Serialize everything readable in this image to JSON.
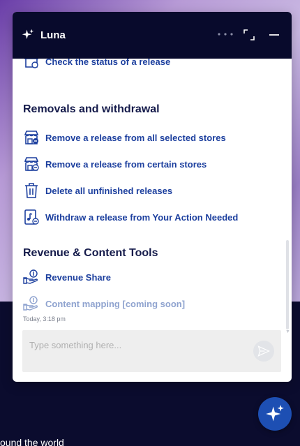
{
  "app": {
    "title": "Luna"
  },
  "content": {
    "partial_item": {
      "label": "Check the status of a release",
      "icon": "store-check-icon"
    },
    "sections": [
      {
        "title": "Removals and withdrawal",
        "items": [
          {
            "label": "Remove a release from all selected stores",
            "icon": "store-remove-icon"
          },
          {
            "label": "Remove a release from certain stores",
            "icon": "store-remove-partial-icon"
          },
          {
            "label": "Delete all unfinished releases",
            "icon": "trash-icon"
          },
          {
            "label": "Withdraw a release from Your Action Needed",
            "icon": "music-doc-withdraw-icon"
          }
        ]
      },
      {
        "title": "Revenue & Content Tools",
        "items": [
          {
            "label": "Revenue Share",
            "icon": "hand-coin-icon"
          },
          {
            "label": "Content mapping [coming soon]",
            "icon": "hand-coin-icon",
            "disabled": true
          }
        ]
      }
    ],
    "timestamp": "Today, 3:18 pm"
  },
  "composer": {
    "placeholder": "Type something here..."
  },
  "backdrop": {
    "text": "ound the world"
  },
  "colors": {
    "header_bg": "#080a2c",
    "link": "#1c3f9e",
    "link_disabled": "#8fa3cf",
    "heading": "#141a4a",
    "fab_bg": "#1d4fb3"
  }
}
